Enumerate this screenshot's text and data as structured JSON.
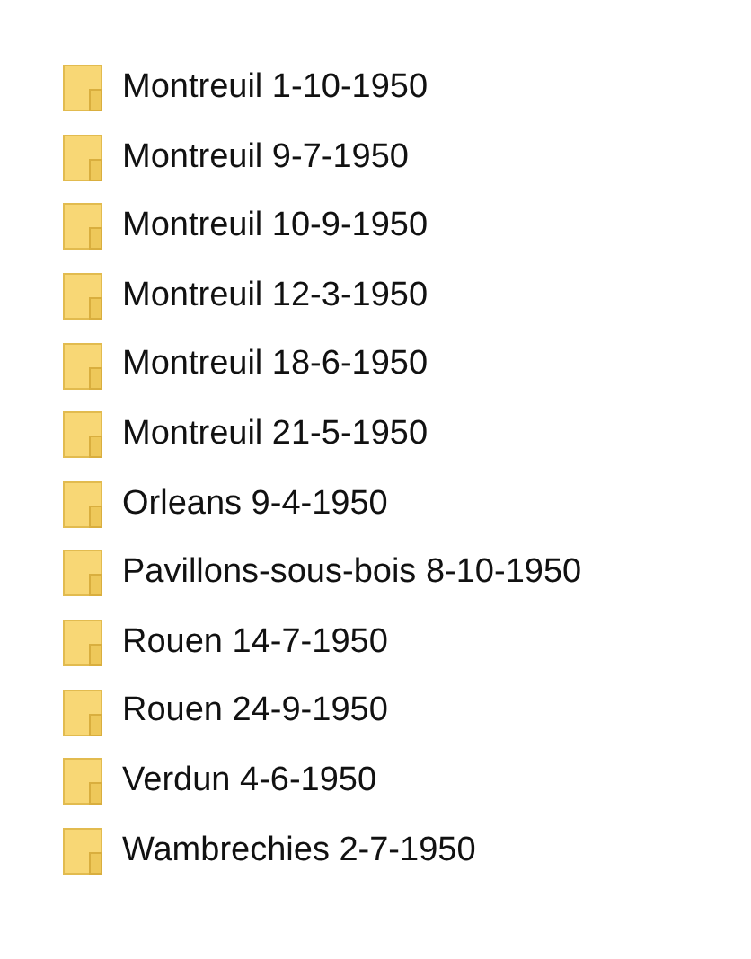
{
  "folders": [
    {
      "name": "Montreuil 1-10-1950"
    },
    {
      "name": "Montreuil 9-7-1950"
    },
    {
      "name": "Montreuil 10-9-1950"
    },
    {
      "name": "Montreuil 12-3-1950"
    },
    {
      "name": "Montreuil 18-6-1950"
    },
    {
      "name": "Montreuil 21-5-1950"
    },
    {
      "name": "Orleans 9-4-1950"
    },
    {
      "name": "Pavillons-sous-bois 8-10-1950"
    },
    {
      "name": "Rouen 14-7-1950"
    },
    {
      "name": "Rouen 24-9-1950"
    },
    {
      "name": "Verdun 4-6-1950"
    },
    {
      "name": "Wambrechies 2-7-1950"
    }
  ]
}
